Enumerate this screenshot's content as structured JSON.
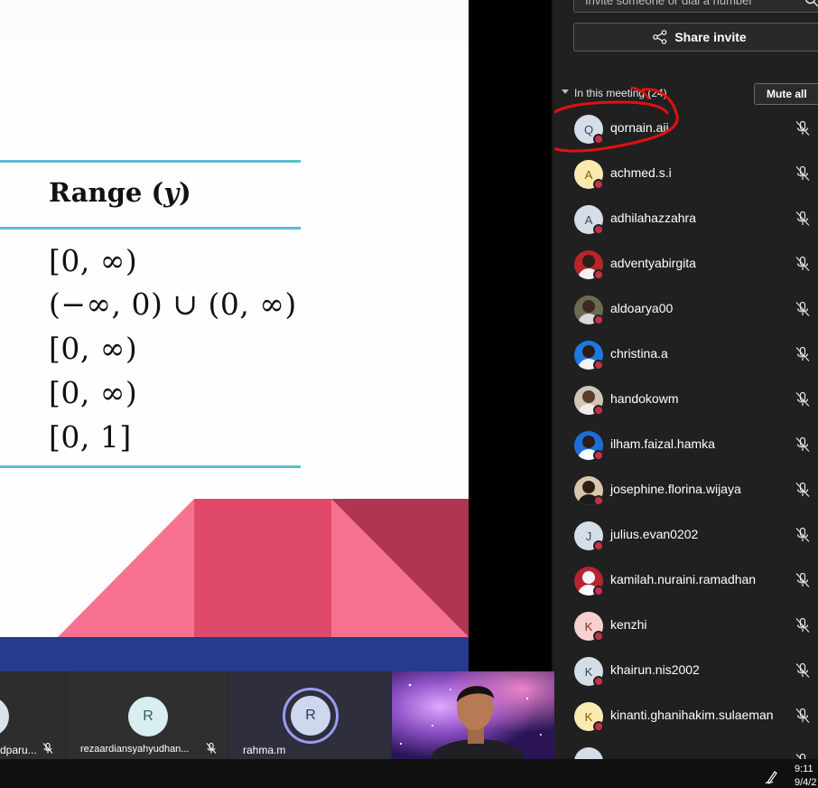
{
  "slide": {
    "range_heading_prefix": "Range (",
    "range_heading_var": "y",
    "range_heading_suffix": ")",
    "range_values": [
      "[0, ∞)",
      "(−∞, 0) ∪ (0, ∞)",
      "[0, ∞)",
      "[0, ∞)",
      "[0, 1]"
    ],
    "colors": {
      "rule": "#5bbfd1",
      "pink_light": "#f87290",
      "pink_mid": "#e04a6a",
      "crimson": "#b03552",
      "navy": "#263a8e"
    }
  },
  "panel": {
    "invite_placeholder": "Invite someone or dial a number",
    "share_invite_label": "Share invite",
    "section_title": "In this meeting (24)",
    "mute_all_label": "Mute all",
    "participants": [
      {
        "name": "qornain.aji",
        "initial": "Q",
        "avatar_bg": "#d5dee8",
        "avatar_fg": "#37475a",
        "photo": false
      },
      {
        "name": "achmed.s.i",
        "initial": "A",
        "avatar_bg": "#fbeab0",
        "avatar_fg": "#7a5b00",
        "photo": false
      },
      {
        "name": "adhilahazzahra",
        "initial": "A",
        "avatar_bg": "#d5dee8",
        "avatar_fg": "#37475a",
        "photo": false
      },
      {
        "name": "adventyabirgita",
        "initial": "",
        "avatar_bg": "#b8242a",
        "avatar_fg": "#ffffff",
        "photo": true,
        "photo_head": "#2b1d18",
        "photo_body": "#f2f2f2"
      },
      {
        "name": "aldoarya00",
        "initial": "",
        "avatar_bg": "#6b6b55",
        "avatar_fg": "#ffffff",
        "photo": true,
        "photo_head": "#3d2a20",
        "photo_body": "#d9d9d9"
      },
      {
        "name": "christina.a",
        "initial": "",
        "avatar_bg": "#1e78e0",
        "avatar_fg": "#ffffff",
        "photo": true,
        "photo_head": "#2a1c14",
        "photo_body": "#f5f5f5"
      },
      {
        "name": "handokowm",
        "initial": "",
        "avatar_bg": "#cfc6b8",
        "avatar_fg": "#ffffff",
        "photo": true,
        "photo_head": "#5a3c2c",
        "photo_body": "#ececec"
      },
      {
        "name": "ilham.faizal.hamka",
        "initial": "",
        "avatar_bg": "#1d6ed8",
        "avatar_fg": "#ffffff",
        "photo": true,
        "photo_head": "#2c1d16",
        "photo_body": "#ffffff"
      },
      {
        "name": "josephine.florina.wijaya",
        "initial": "",
        "avatar_bg": "#d9c7a9",
        "avatar_fg": "#ffffff",
        "photo": true,
        "photo_head": "#2d1e16",
        "photo_body": "#1b1b1b"
      },
      {
        "name": "julius.evan0202",
        "initial": "J",
        "avatar_bg": "#d5dee8",
        "avatar_fg": "#37475a",
        "photo": false
      },
      {
        "name": "kamilah.nuraini.ramadhan",
        "initial": "",
        "avatar_bg": "#b52430",
        "avatar_fg": "#ffffff",
        "photo": true,
        "photo_head": "#f3f3f3",
        "photo_body": "#ffffff"
      },
      {
        "name": "kenzhi",
        "initial": "K",
        "avatar_bg": "#f7d0cf",
        "avatar_fg": "#8a2b2b",
        "photo": false
      },
      {
        "name": "khairun.nis2002",
        "initial": "K",
        "avatar_bg": "#d5dee8",
        "avatar_fg": "#37475a",
        "photo": false
      },
      {
        "name": "kinanti.ghanihakim.sulaeman",
        "initial": "K",
        "avatar_bg": "#fbeab0",
        "avatar_fg": "#7a5b00",
        "photo": false
      },
      {
        "name": "",
        "initial": "",
        "avatar_bg": "#d5dee8",
        "avatar_fg": "#37475a",
        "photo": false
      }
    ]
  },
  "strip": {
    "tiles": [
      {
        "name": "dparu...",
        "initial": "",
        "bg": "#2d2d2d",
        "circle_bg": "#d8e4ec",
        "circle_fg": "#37475a",
        "ring": false,
        "muted": true
      },
      {
        "name": "rezaardiansyahyudhan...",
        "initial": "R",
        "bg": "#2f2f2f",
        "circle_bg": "#d9eef0",
        "circle_fg": "#2e5d63",
        "ring": false,
        "muted": true
      },
      {
        "name": "rahma.m",
        "initial": "R",
        "bg": "#2e2e3c",
        "circle_bg": "#cdd8ee",
        "circle_fg": "#2b3a5c",
        "ring": true,
        "muted": false
      }
    ]
  },
  "taskbar": {
    "time": "9:11",
    "date": "9/4/2"
  }
}
